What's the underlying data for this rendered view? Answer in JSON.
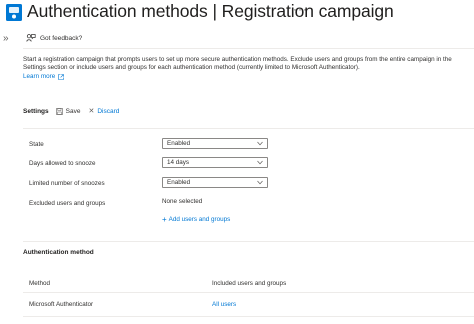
{
  "header": {
    "title": "Authentication methods | Registration campaign",
    "more_label": "···"
  },
  "commandbar": {
    "expand_label": "»",
    "feedback_label": "Got feedback?"
  },
  "description": {
    "text": "Start a registration campaign that prompts users to set up more secure authentication methods. Exclude users and groups from the entire campaign in the Settings section or include users and groups for each authentication method (currently limited to Microsoft Authenticator).",
    "learn_more": "Learn more"
  },
  "settings": {
    "title": "Settings",
    "save_label": "Save",
    "discard_label": "Discard",
    "state_label": "State",
    "state_value": "Enabled",
    "snooze_days_label": "Days allowed to snooze",
    "snooze_days_value": "14 days",
    "limited_snoozes_label": "Limited number of snoozes",
    "limited_snoozes_value": "Enabled",
    "excluded_label": "Excluded users and groups",
    "excluded_value": "None selected",
    "add_label": "Add users and groups"
  },
  "auth_method": {
    "title": "Authentication method",
    "columns": [
      "Method",
      "Included users and groups"
    ],
    "rows": [
      {
        "method": "Microsoft Authenticator",
        "included": "All users"
      }
    ]
  },
  "colors": {
    "accent": "#0078d4",
    "text": "#323130",
    "border": "#8a8886",
    "divider": "#edebe9"
  }
}
